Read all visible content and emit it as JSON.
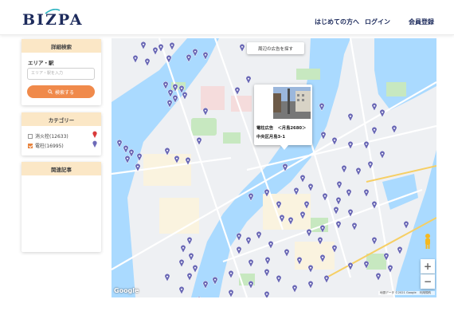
{
  "header": {
    "logo": "BIZPA",
    "nav": [
      "はじめての方へ",
      "ログイン",
      "会員登録"
    ]
  },
  "sidebar": {
    "detail_search": {
      "title": "詳細検索",
      "area_label": "エリア・駅",
      "area_placeholder": "エリア・駅を入力",
      "search_button": "検索する"
    },
    "category": {
      "title": "カテゴリー",
      "items": [
        {
          "label": "消火栓(12633)",
          "checked": false,
          "pin_color": "#d93a3a"
        },
        {
          "label": "電柱(16995)",
          "checked": true,
          "pin_color": "#6d6ab8"
        }
      ]
    },
    "related": {
      "title": "関連記事"
    }
  },
  "map": {
    "banner": "周辺の広告を探す",
    "popup": {
      "line1": "電柱広告　＜月島2680＞",
      "line2": "中央区月島3-1"
    },
    "zoom_in": "+",
    "zoom_out": "−",
    "google": "Google",
    "attribution": [
      "地図データ ©2021 Google",
      "利用規約"
    ],
    "pin_color": "#6a68b5",
    "water_color": "#aadaff"
  }
}
